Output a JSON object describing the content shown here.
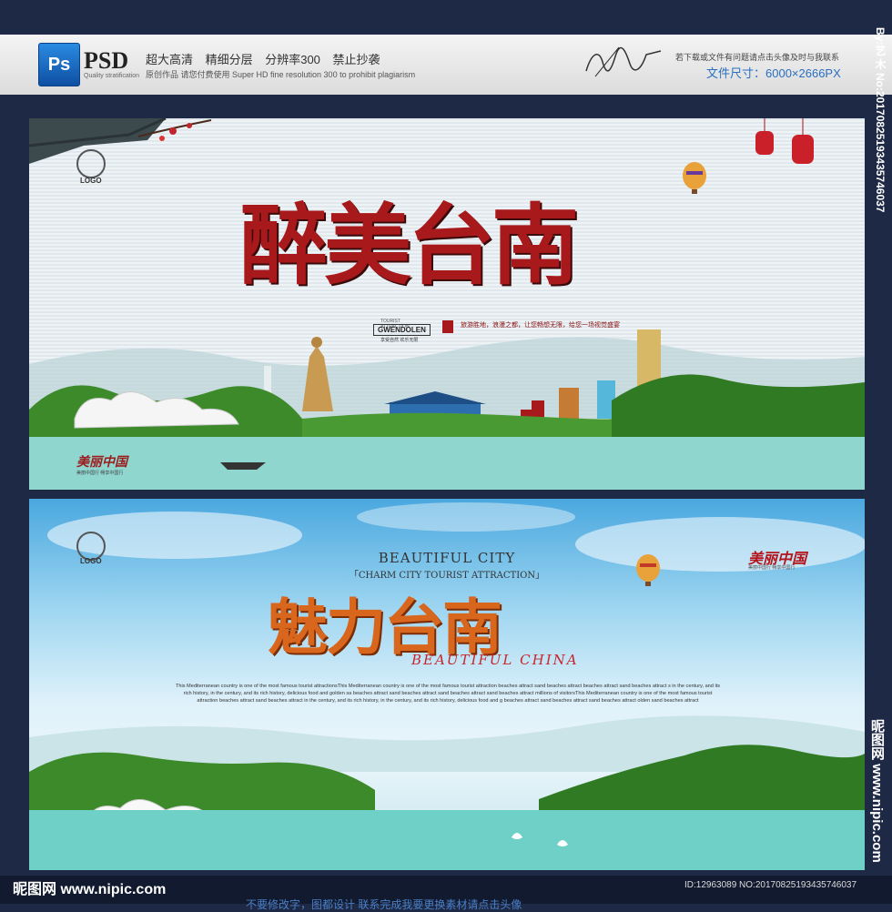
{
  "header": {
    "ps_icon": "Ps",
    "psd_label": "PSD",
    "psd_sub": "Quality stratification",
    "features": "超大高清 精细分层 分辨率300 禁止抄袭",
    "features_sub": "原创作品 请您付费使用 Super HD fine resolution 300 to prohibit plagiarism",
    "right_note": "若下载或文件有问题请点击头像及时与我联系",
    "file_size": "文件尺寸：6000×2666PX"
  },
  "side": {
    "top_text": "By:艺 木 No:20170825193435746037",
    "bottom_text": "昵图网 www.nipic.com"
  },
  "panel1": {
    "title": "醉美台南",
    "logo": "LOGO",
    "attraction_label": "TOURIST ATTRACTION",
    "gwendolen": "GWENDOLEN",
    "gwendolen_sub": "享受自然 欢乐无限",
    "tagline": "旅游胜地，浪漫之都，让您畅想无限，给您一场视觉盛宴",
    "beautiful_china": "美丽中国",
    "beautiful_china_sub": "美丽中国行 畅享中国行"
  },
  "panel2": {
    "logo": "LOGO",
    "city_title": "BEAUTIFUL CITY",
    "city_sub": "「CHARM CITY TOURIST ATTRACTION」",
    "title": "魅力台南",
    "title_en": "BEAUTIFUL CHINA",
    "paragraph": "This Mediterranean country is one of the most famous tourist attractionsThis Mediterranean country is one of the most famous tourist attraction beaches attract sand beaches attract beaches attract sand beaches attract s in the century, and its rich history, in the century, and its rich history, delicious food and golden sa beaches attract sand beaches attract sand beaches attract sand beaches attract millions of visitorsThis Mediterranean country is one of the most famous tourist attraction beaches attract sand beaches attract in the century, and its rich history, in the century, and its rich history, delicious food and g beaches attract sand beaches attract sand beaches attract olden sand beaches attract",
    "beautiful_china": "美丽中国",
    "beautiful_china_sub": "美丽中国行 畅享中国行"
  },
  "footer": {
    "site": "昵图网 www.nipic.com",
    "id": "ID:12963089 NO:20170825193435746037",
    "strip": "不要修改字，图都设计 联系完成我要更换素材请点击头像"
  },
  "colors": {
    "red_title": "#a8191b",
    "orange_title": "#d8661d",
    "sky": "#4aa8df",
    "water": "#6fd0c8",
    "tree_green": "#3d8a2a"
  }
}
